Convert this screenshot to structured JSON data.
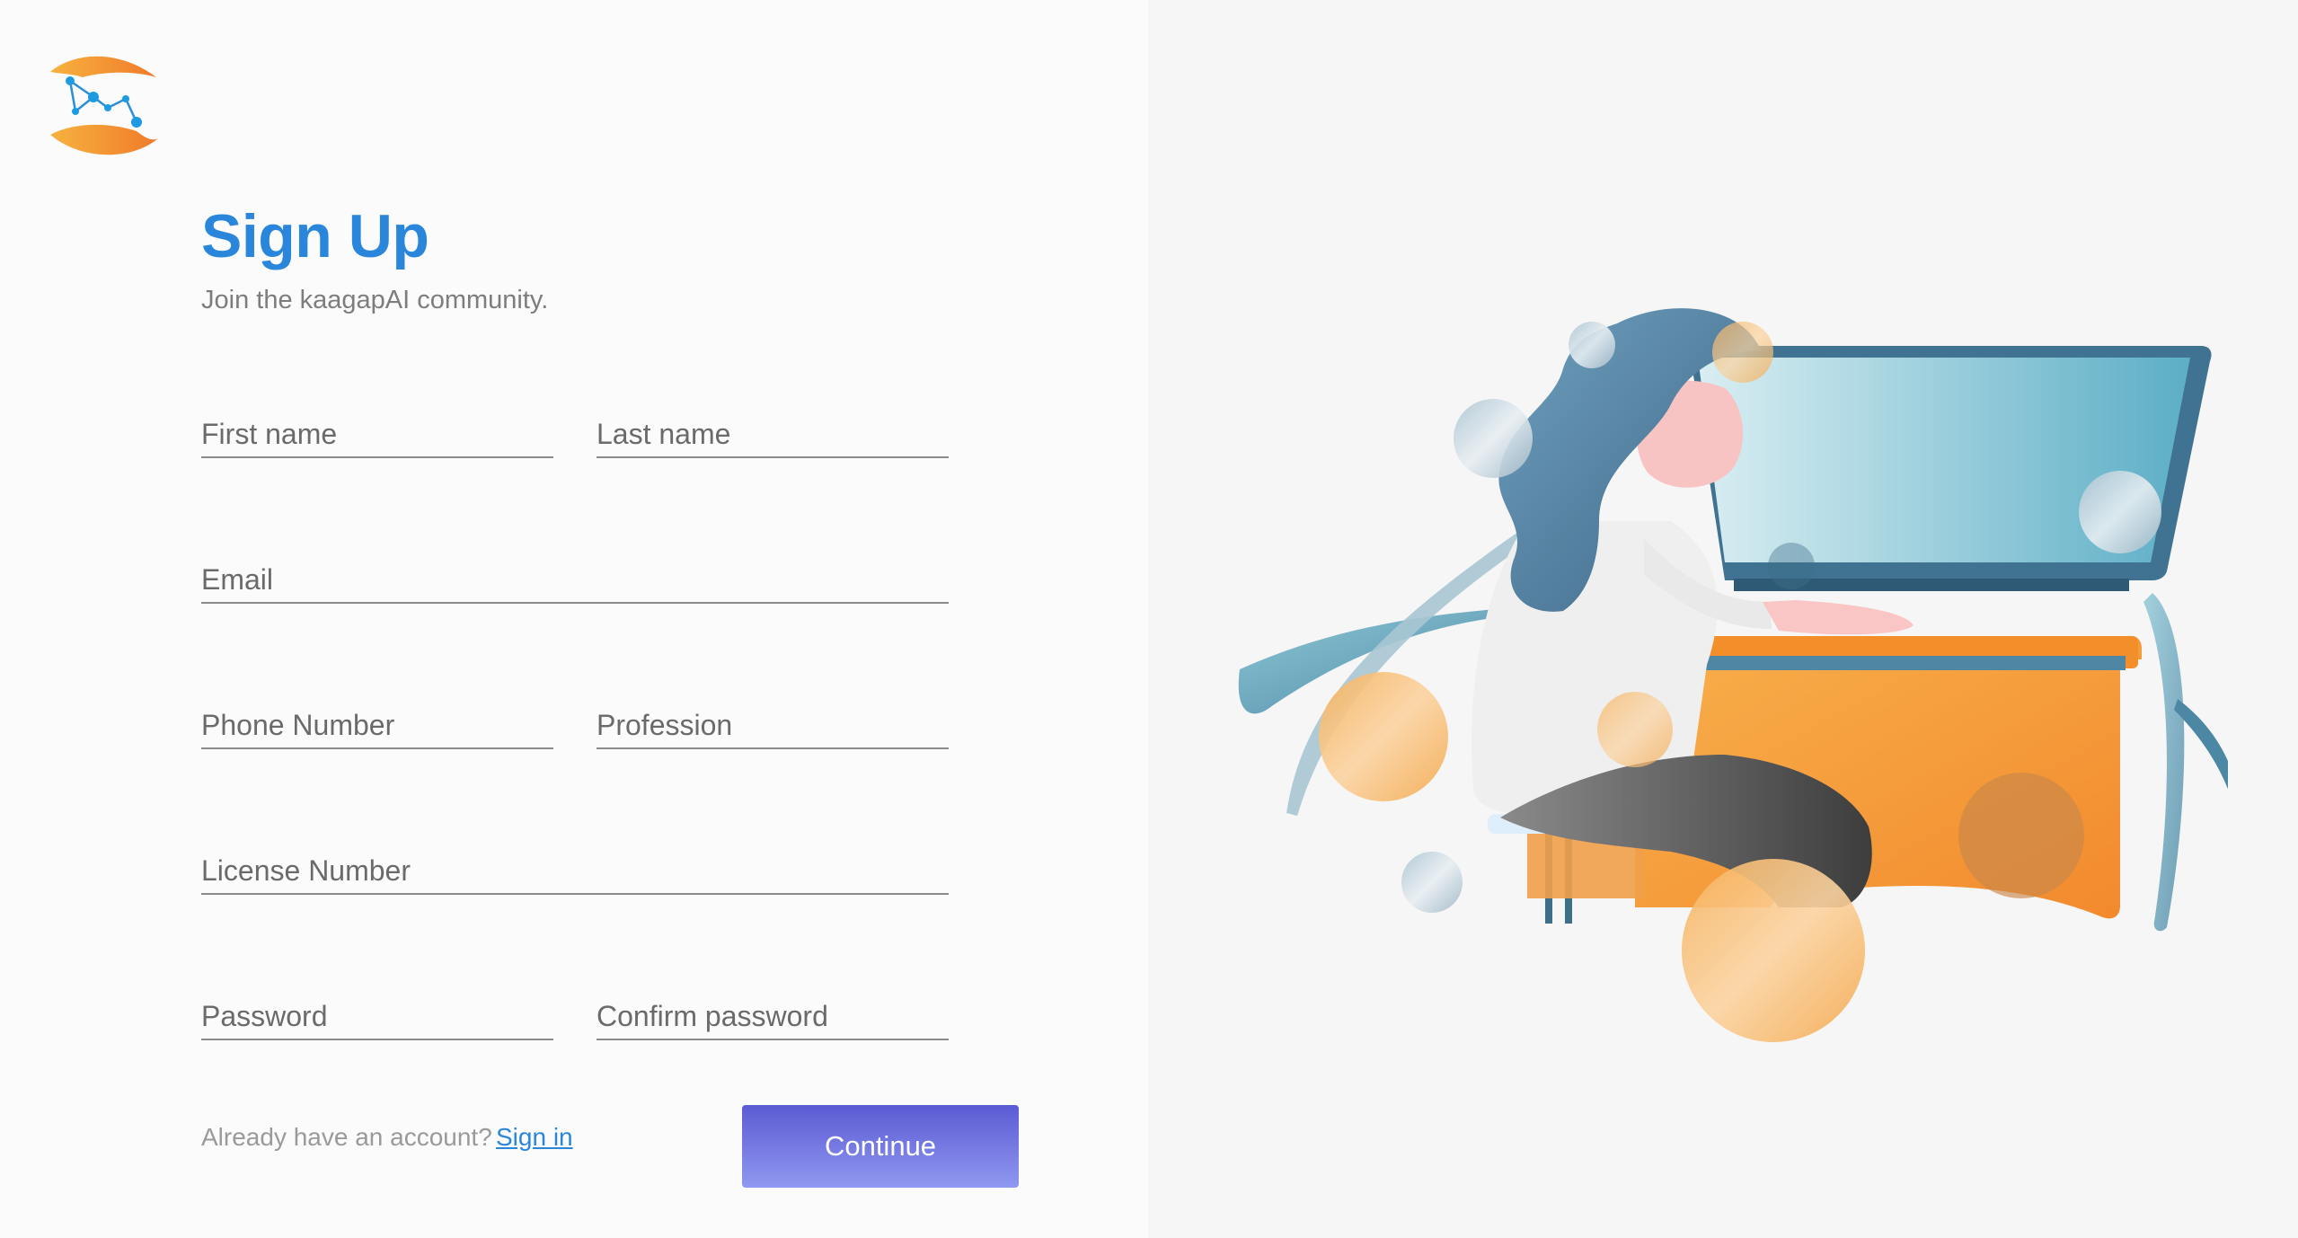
{
  "brand": {
    "logo_icon": "kaagapai-hands-network-logo",
    "accent_color": "#2a86da",
    "button_color": "#6b6be0",
    "logo_orange": "#f59a3a"
  },
  "form": {
    "title": "Sign Up",
    "subtitle": "Join the kaagapAI community.",
    "fields": {
      "first_name": "First name",
      "last_name": "Last name",
      "email": "Email",
      "phone_number": "Phone Number",
      "profession": "Profession",
      "license_number": "License Number",
      "password": "Password",
      "confirm_password": "Confirm password"
    },
    "footer": {
      "prompt": "Already have an account?",
      "signin_label": "Sign in"
    },
    "continue_label": "Continue"
  },
  "illustration": {
    "icon": "woman-at-computer-illustration"
  }
}
